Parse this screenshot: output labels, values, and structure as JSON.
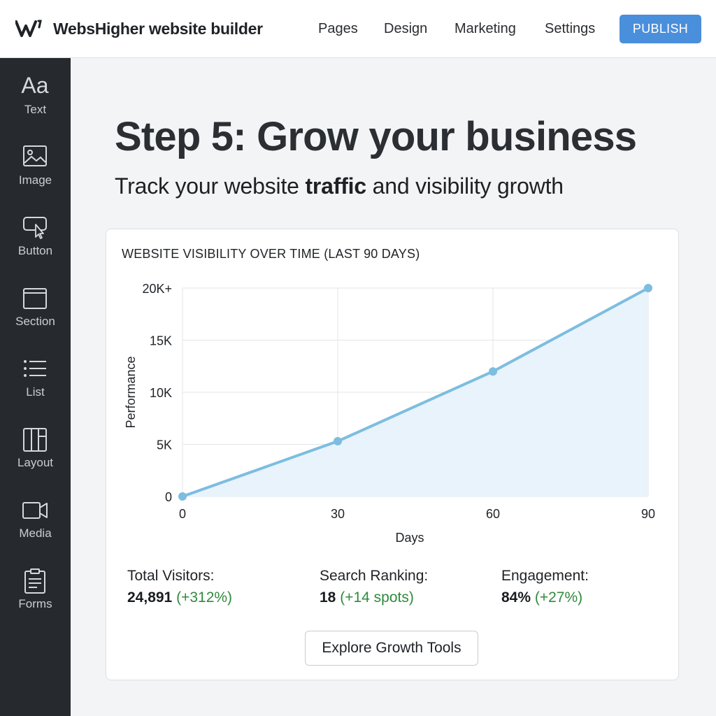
{
  "header": {
    "brand": "WebsHigher website builder",
    "nav": [
      "Pages",
      "Design",
      "Marketing",
      "Settings"
    ],
    "publish_label": "PUBLISH"
  },
  "sidebar": {
    "items": [
      {
        "label": "Text",
        "icon": "text-aa-icon"
      },
      {
        "label": "Image",
        "icon": "image-icon"
      },
      {
        "label": "Button",
        "icon": "button-cursor-icon"
      },
      {
        "label": "Section",
        "icon": "section-icon"
      },
      {
        "label": "List",
        "icon": "list-icon"
      },
      {
        "label": "Layout",
        "icon": "layout-icon"
      },
      {
        "label": "Media",
        "icon": "video-camera-icon"
      },
      {
        "label": "Forms",
        "icon": "clipboard-icon"
      }
    ],
    "text_icon_glyph": "Aa"
  },
  "main": {
    "title": "Step 5: Grow your business",
    "subtitle_pre": "Track your website ",
    "subtitle_bold": "traffic",
    "subtitle_post": " and visibility growth"
  },
  "chart_data": {
    "type": "area",
    "title": "WEBSITE VISIBILITY OVER TIME (LAST 90 DAYS)",
    "xlabel": "Days",
    "ylabel": "Performance",
    "x": [
      0,
      30,
      60,
      90
    ],
    "series": [
      {
        "values": [
          0,
          5300,
          12000,
          20000
        ]
      }
    ],
    "xlim": [
      0,
      90
    ],
    "ylim": [
      0,
      20000
    ],
    "x_ticks": [
      0,
      30,
      60,
      90
    ],
    "y_ticks": [
      0,
      5000,
      10000,
      15000,
      20000
    ],
    "y_tick_labels": [
      "0",
      "5K",
      "10K",
      "15K",
      "20K+"
    ],
    "grid": true,
    "line_color": "#7dbde0",
    "fill_color": "#e8f3fb"
  },
  "stats": [
    {
      "label": "Total Visitors:",
      "value": "24,891",
      "delta": "(+312%)"
    },
    {
      "label": "Search Ranking:",
      "value": "18",
      "delta": "(+14 spots)"
    },
    {
      "label": "Engagement:",
      "value": "84%",
      "delta": "(+27%)"
    }
  ],
  "cta_label": "Explore Growth Tools",
  "colors": {
    "accent": "#4a8fdb",
    "sidebar_bg": "#262a2e",
    "positive": "#2f8a3c"
  }
}
